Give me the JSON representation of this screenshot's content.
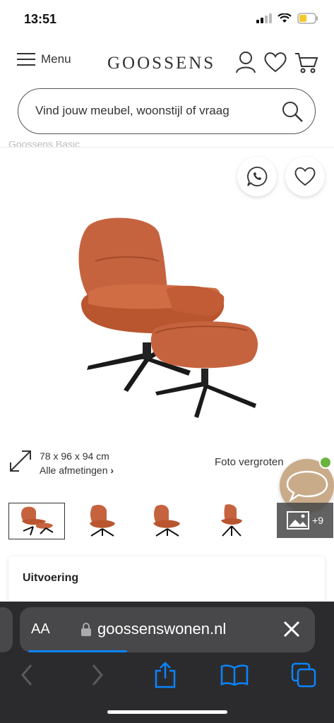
{
  "status_bar": {
    "time": "13:51"
  },
  "header": {
    "menu_label": "Menu",
    "logo": "GOOSSENS"
  },
  "search": {
    "placeholder": "Vind jouw meubel, woonstijl of vraag"
  },
  "product": {
    "brand": "Goossens Basic",
    "dimensions": "78 x 96 x 94 cm",
    "all_dimensions_link": "Alle afmetingen",
    "zoom_label": "Foto vergroten",
    "more_photos": "+9",
    "color_accent": "#c6633f"
  },
  "options": {
    "title": "Uitvoering"
  },
  "browser": {
    "aa_label": "AA",
    "url": "goossenswonen.nl",
    "accent": "#0a84ff"
  }
}
